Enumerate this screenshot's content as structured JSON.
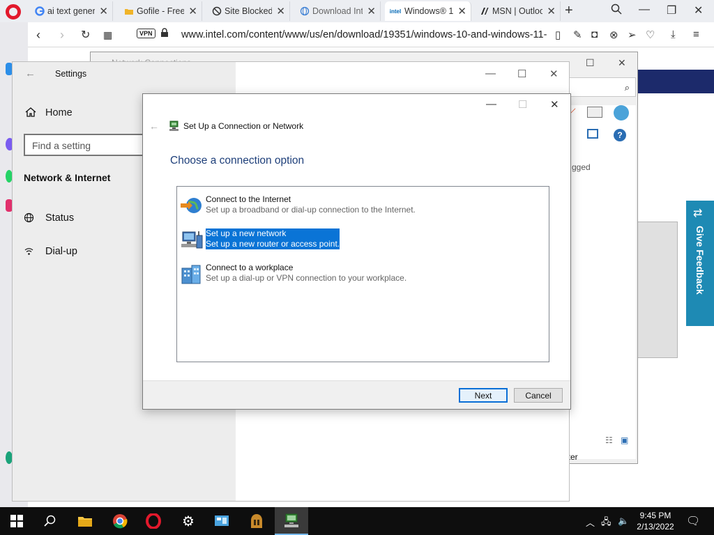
{
  "browser": {
    "tabs": [
      {
        "title": "ai text genera",
        "favicon": "google-icon"
      },
      {
        "title": "Gofile - Free",
        "favicon": "folder-icon"
      },
      {
        "title": "Site Blocked",
        "favicon": "blocked-icon"
      },
      {
        "title": "Download Int",
        "favicon": "globe-icon"
      },
      {
        "title": "Windows® 1(",
        "favicon": "intel-icon",
        "favicon_text": "intel"
      },
      {
        "title": "MSN | Outloo",
        "favicon": "msn-icon"
      }
    ],
    "vpn_label": "VPN",
    "url": "www.intel.com/content/www/us/en/download/19351/windows-10-and-windows-11-"
  },
  "webpage": {
    "feedback_label": "Give Feedback",
    "partial_text_1": "gged",
    "partial_text_2": "uter"
  },
  "netconn": {
    "title": "Network Connections"
  },
  "settings": {
    "title": "Settings",
    "home_label": "Home",
    "search_placeholder": "Find a setting",
    "section_title": "Network & Internet",
    "items": [
      {
        "label": "Status",
        "icon": "globe-icon"
      },
      {
        "label": "Dial-up",
        "icon": "dialup-icon"
      }
    ]
  },
  "dialog": {
    "title": "Set Up a Connection or Network",
    "heading": "Choose a connection option",
    "options": [
      {
        "title": "Connect to the Internet",
        "desc": "Set up a broadband or dial-up connection to the Internet.",
        "icon": "internet-globe-icon",
        "selected": false
      },
      {
        "title": "Set up a new network",
        "desc": "Set up a new router or access point.",
        "icon": "network-computer-icon",
        "selected": true
      },
      {
        "title": "Connect to a workplace",
        "desc": "Set up a dial-up or VPN connection to your workplace.",
        "icon": "workplace-building-icon",
        "selected": false
      }
    ],
    "next_label": "Next",
    "cancel_label": "Cancel"
  },
  "taskbar": {
    "time": "9:45 PM",
    "date": "2/13/2022"
  },
  "colors": {
    "accent": "#0a74d6",
    "heading": "#1e3f7a",
    "opera_red": "#e2192c",
    "taskbar": "#0e0e0e"
  }
}
